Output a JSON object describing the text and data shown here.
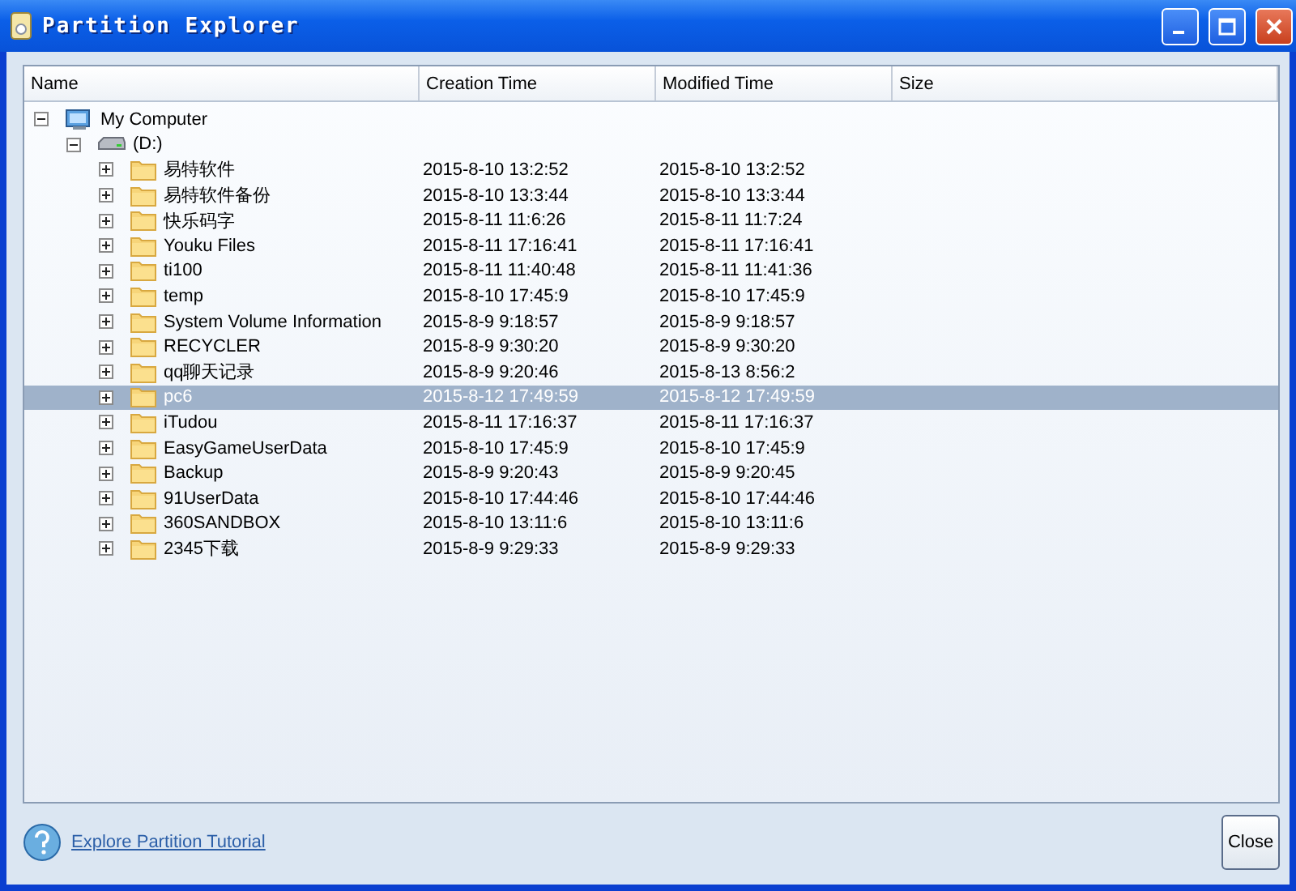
{
  "window": {
    "title": "Partition Explorer"
  },
  "columns": [
    "Name",
    "Creation Time",
    "Modified Time",
    "Size"
  ],
  "tree": [
    {
      "kind": "computer",
      "name": "My Computer",
      "expanded": true,
      "selected": false,
      "children": [
        {
          "kind": "drive",
          "name": "(D:)",
          "expanded": true,
          "selected": false,
          "children": [
            {
              "kind": "folder",
              "name": "易特软件",
              "created": "2015-8-10 13:2:52",
              "modified": "2015-8-10 13:2:52",
              "expanded": false,
              "selected": false
            },
            {
              "kind": "folder",
              "name": "易特软件备份",
              "created": "2015-8-10 13:3:44",
              "modified": "2015-8-10 13:3:44",
              "expanded": false,
              "selected": false
            },
            {
              "kind": "folder",
              "name": "快乐码字",
              "created": "2015-8-11 11:6:26",
              "modified": "2015-8-11 11:7:24",
              "expanded": false,
              "selected": false
            },
            {
              "kind": "folder",
              "name": "Youku Files",
              "created": "2015-8-11 17:16:41",
              "modified": "2015-8-11 17:16:41",
              "expanded": false,
              "selected": false
            },
            {
              "kind": "folder",
              "name": "ti100",
              "created": "2015-8-11 11:40:48",
              "modified": "2015-8-11 11:41:36",
              "expanded": false,
              "selected": false
            },
            {
              "kind": "folder",
              "name": "temp",
              "created": "2015-8-10 17:45:9",
              "modified": "2015-8-10 17:45:9",
              "expanded": false,
              "selected": false
            },
            {
              "kind": "folder",
              "name": "System Volume Information",
              "created": "2015-8-9 9:18:57",
              "modified": "2015-8-9 9:18:57",
              "expanded": false,
              "selected": false
            },
            {
              "kind": "folder",
              "name": "RECYCLER",
              "created": "2015-8-9 9:30:20",
              "modified": "2015-8-9 9:30:20",
              "expanded": false,
              "selected": false
            },
            {
              "kind": "folder",
              "name": "qq聊天记录",
              "created": "2015-8-9 9:20:46",
              "modified": "2015-8-13 8:56:2",
              "expanded": false,
              "selected": false
            },
            {
              "kind": "folder",
              "name": "pc6",
              "created": "2015-8-12 17:49:59",
              "modified": "2015-8-12 17:49:59",
              "expanded": false,
              "selected": true
            },
            {
              "kind": "folder",
              "name": "iTudou",
              "created": "2015-8-11 17:16:37",
              "modified": "2015-8-11 17:16:37",
              "expanded": false,
              "selected": false
            },
            {
              "kind": "folder",
              "name": "EasyGameUserData",
              "created": "2015-8-10 17:45:9",
              "modified": "2015-8-10 17:45:9",
              "expanded": false,
              "selected": false
            },
            {
              "kind": "folder",
              "name": "Backup",
              "created": "2015-8-9 9:20:43",
              "modified": "2015-8-9 9:20:45",
              "expanded": false,
              "selected": false
            },
            {
              "kind": "folder",
              "name": "91UserData",
              "created": "2015-8-10 17:44:46",
              "modified": "2015-8-10 17:44:46",
              "expanded": false,
              "selected": false
            },
            {
              "kind": "folder",
              "name": "360SANDBOX",
              "created": "2015-8-10 13:11:6",
              "modified": "2015-8-10 13:11:6",
              "expanded": false,
              "selected": false
            },
            {
              "kind": "folder",
              "name": "2345下载",
              "created": "2015-8-9 9:29:33",
              "modified": "2015-8-9 9:29:33",
              "expanded": false,
              "selected": false
            }
          ]
        }
      ]
    }
  ],
  "footer": {
    "link": "Explore Partition Tutorial",
    "button": "Close"
  }
}
